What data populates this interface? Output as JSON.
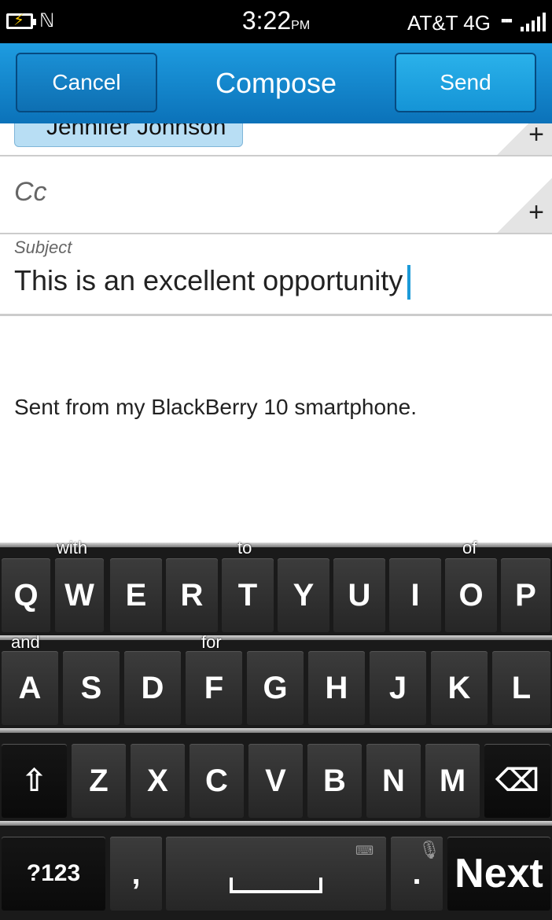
{
  "status_bar": {
    "time": "3:22",
    "ampm": "PM",
    "carrier": "AT&T 4G",
    "icons": [
      "battery-charging-icon",
      "nfc-icon",
      "bbm-icon",
      "signal-icon"
    ]
  },
  "titlebar": {
    "cancel_label": "Cancel",
    "title": "Compose",
    "send_label": "Send"
  },
  "to": {
    "recipient": "Jennifer Johnson",
    "add_icon": "+"
  },
  "cc": {
    "placeholder": "Cc",
    "add_icon": "+"
  },
  "subject": {
    "label": "Subject",
    "value": "This is an excellent opportunity"
  },
  "body": {
    "signature": "Sent from my BlackBerry 10 smartphone."
  },
  "keyboard": {
    "predictions": [
      "with",
      "to",
      "of",
      "and",
      "for"
    ],
    "row1": [
      "Q",
      "W",
      "E",
      "R",
      "T",
      "Y",
      "U",
      "I",
      "O",
      "P"
    ],
    "row2": [
      "A",
      "S",
      "D",
      "F",
      "G",
      "H",
      "J",
      "K",
      "L"
    ],
    "row3": [
      "Z",
      "X",
      "C",
      "V",
      "B",
      "N",
      "M"
    ],
    "shift_icon": "⇧",
    "backspace_icon": "⌫",
    "symbols_label": "?123",
    "comma_label": ",",
    "period_label": ".",
    "enter_label": "Next"
  },
  "colors": {
    "accent": "#1b9ad8",
    "titlebar": "#0b72b9",
    "chip": "#b8def4"
  }
}
